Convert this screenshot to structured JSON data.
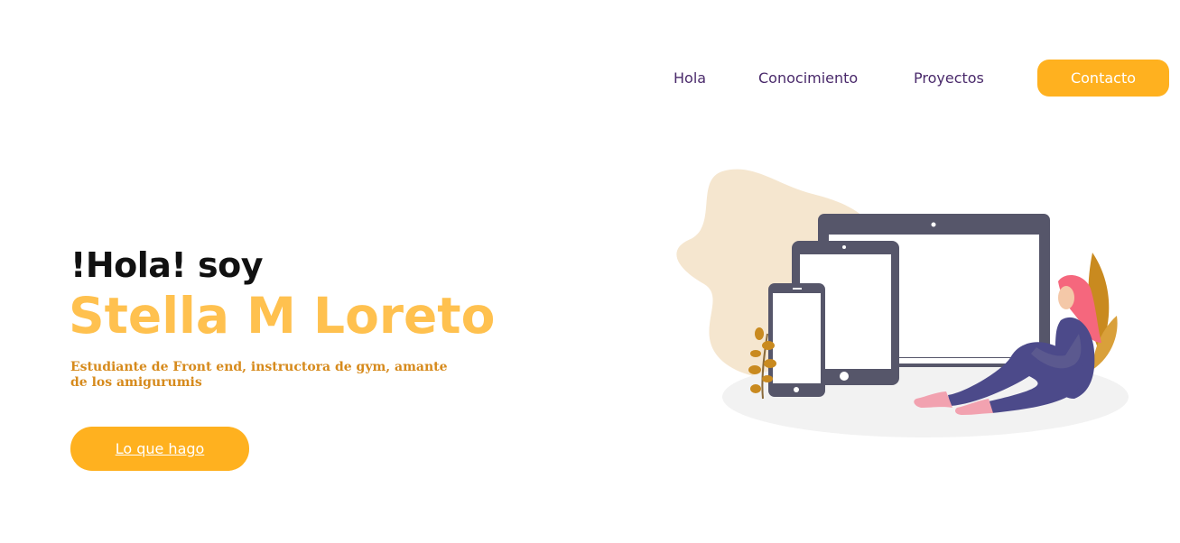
{
  "nav": {
    "items": [
      {
        "label": "Hola"
      },
      {
        "label": "Conocimiento"
      },
      {
        "label": "Proyectos"
      }
    ],
    "contact_label": "Contacto"
  },
  "hero": {
    "greeting": "!Hola! soy",
    "name": "Stella M Loreto",
    "description": "Estudiante de Front end, instructora de gym, amante de los amigurumis",
    "cta_label": "Lo que hago"
  },
  "colors": {
    "accent": "#ffb11f",
    "name_color": "#ffc14f",
    "nav_text": "#4a2a6b",
    "description_text": "#d68a1c"
  },
  "illustration": {
    "icon": "devices-person-illustration"
  }
}
